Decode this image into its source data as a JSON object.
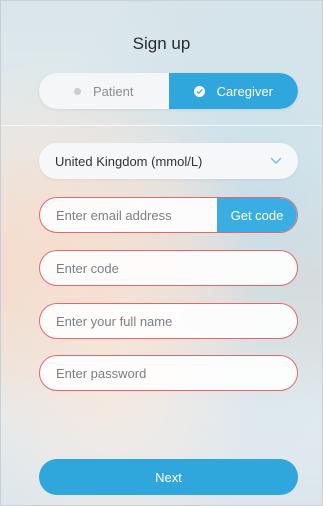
{
  "header": {
    "title": "Sign up"
  },
  "role_toggle": {
    "patient_label": "Patient",
    "caregiver_label": "Caregiver",
    "selected": "Caregiver"
  },
  "region_select": {
    "value": "United Kingdom (mmol/L)"
  },
  "form": {
    "email_placeholder": "Enter email address",
    "get_code_label": "Get code",
    "code_placeholder": "Enter code",
    "name_placeholder": "Enter your full name",
    "password_placeholder": "Enter password"
  },
  "footer": {
    "next_label": "Next"
  },
  "colors": {
    "accent": "#2fa7dd",
    "field_border": "#e2686c"
  }
}
